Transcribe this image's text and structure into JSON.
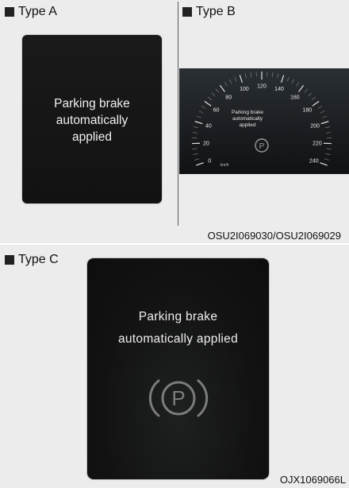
{
  "type_a": {
    "label": "Type A",
    "message_line1": "Parking brake",
    "message_line2": "automatically",
    "message_line3": "applied"
  },
  "type_b": {
    "label": "Type B",
    "message_line1": "Parking brake",
    "message_line2": "automatically",
    "message_line3": "applied",
    "unit": "km/h",
    "ticks": [
      "0",
      "20",
      "40",
      "60",
      "80",
      "100",
      "120",
      "140",
      "160",
      "180",
      "200",
      "220",
      "240"
    ],
    "icon": "parking-brake-icon"
  },
  "figure_codes": {
    "top": "OSU2I069030/OSU2I069029",
    "bottom": "OJX1069066L"
  },
  "type_c": {
    "label": "Type C",
    "message_line1": "Parking brake",
    "message_line2": "automatically applied",
    "icon": "parking-brake-icon"
  },
  "colors": {
    "screen": "#141414",
    "text": "#f0f0f0",
    "icon": "#8a8a8a"
  }
}
